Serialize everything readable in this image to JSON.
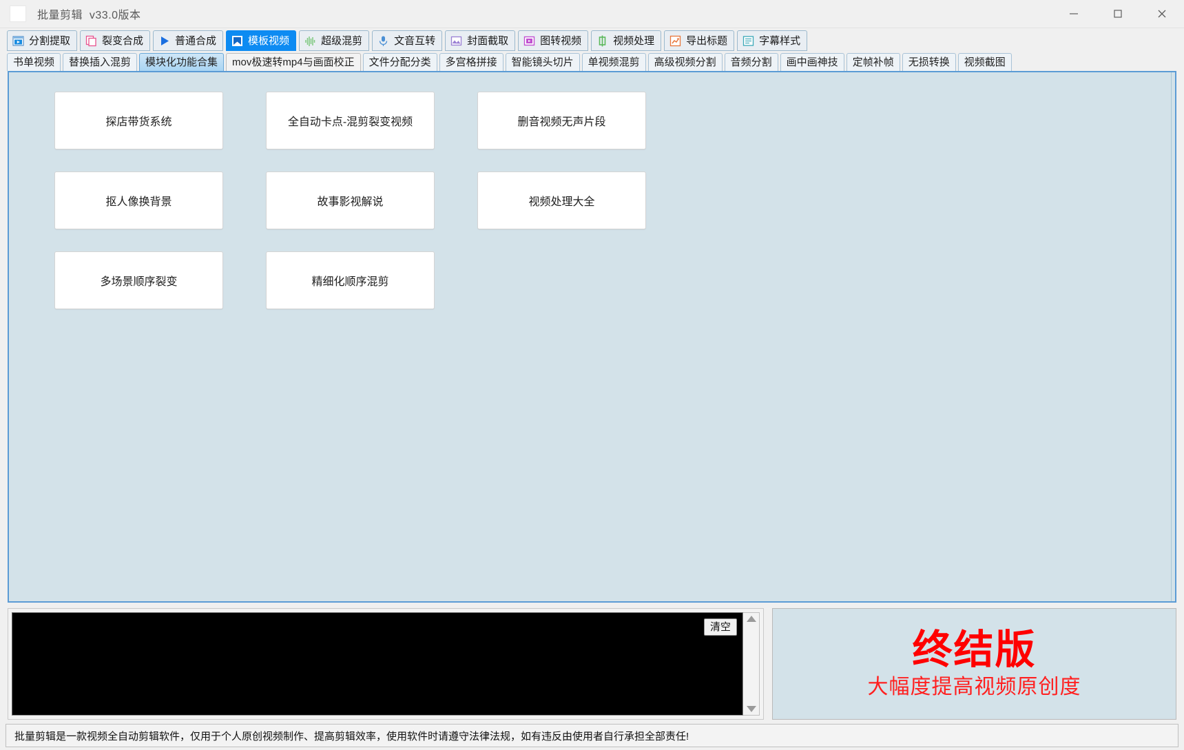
{
  "window": {
    "title": "批量剪辑  v33.0版本",
    "app_icon": "app-icon",
    "minimize": "−",
    "maximize": "□",
    "close": "✕"
  },
  "toolbar": {
    "tabs": [
      {
        "label": "分割提取",
        "icon": "film-split-icon",
        "active": false
      },
      {
        "label": "裂变合成",
        "icon": "copy-pink-icon",
        "active": false
      },
      {
        "label": "普通合成",
        "icon": "play-triangle-icon",
        "active": false
      },
      {
        "label": "模板视频",
        "icon": "template-bookmark-icon",
        "active": true
      },
      {
        "label": "超级混剪",
        "icon": "waveform-icon",
        "active": false
      },
      {
        "label": "文音互转",
        "icon": "microphone-icon",
        "active": false
      },
      {
        "label": "封面截取",
        "icon": "picture-icon",
        "active": false
      },
      {
        "label": "图转视频",
        "icon": "image-to-video-icon",
        "active": false
      },
      {
        "label": "视频处理",
        "icon": "chinese-zhong-icon",
        "active": false
      },
      {
        "label": "导出标题",
        "icon": "export-chart-icon",
        "active": false
      },
      {
        "label": "字幕样式",
        "icon": "subtitle-lines-icon",
        "active": false
      }
    ]
  },
  "subtabs": {
    "tabs": [
      {
        "label": "书单视频",
        "active": false,
        "style": "blue"
      },
      {
        "label": "替换插入混剪",
        "active": false,
        "style": "blue"
      },
      {
        "label": "模块化功能合集",
        "active": true,
        "style": "blue"
      },
      {
        "label": "mov极速转mp4与画面校正",
        "active": false,
        "style": "plain"
      },
      {
        "label": "文件分配分类",
        "active": false,
        "style": "blue"
      },
      {
        "label": "多宫格拼接",
        "active": false,
        "style": "blue"
      },
      {
        "label": "智能镜头切片",
        "active": false,
        "style": "blue"
      },
      {
        "label": "单视频混剪",
        "active": false,
        "style": "blue"
      },
      {
        "label": "高级视频分割",
        "active": false,
        "style": "blue"
      },
      {
        "label": "音频分割",
        "active": false,
        "style": "blue"
      },
      {
        "label": "画中画神技",
        "active": false,
        "style": "blue"
      },
      {
        "label": "定帧补帧",
        "active": false,
        "style": "blue"
      },
      {
        "label": "无损转换",
        "active": false,
        "style": "blue"
      },
      {
        "label": "视频截图",
        "active": false,
        "style": "blue"
      }
    ]
  },
  "main": {
    "functions": [
      {
        "label": "探店带货系统"
      },
      {
        "label": "全自动卡点-混剪裂变视频"
      },
      {
        "label": "删音视频无声片段"
      },
      {
        "label": "抠人像换背景"
      },
      {
        "label": "故事影视解说"
      },
      {
        "label": "视频处理大全"
      },
      {
        "label": "多场景顺序裂变"
      },
      {
        "label": "精细化顺序混剪"
      }
    ]
  },
  "log": {
    "text": "",
    "clear_label": "清空",
    "scroll_up": "scrollbar-up-arrow",
    "scroll_down": "scrollbar-down-arrow"
  },
  "promo": {
    "headline": "终结版",
    "subline": "大幅度提高视频原创度",
    "color": "#ff0000"
  },
  "statusbar": {
    "text": "批量剪辑是一款视频全自动剪辑软件，仅用于个人原创视频制作、提高剪辑效率，使用软件时请遵守法律法规，如有违反由使用者自行承担全部责任!"
  },
  "colors": {
    "accent_blue": "#0d8bf2",
    "panel_bg": "#d3e2e9",
    "panel_border": "#5b9bd5",
    "promo_red": "#ff0000"
  }
}
